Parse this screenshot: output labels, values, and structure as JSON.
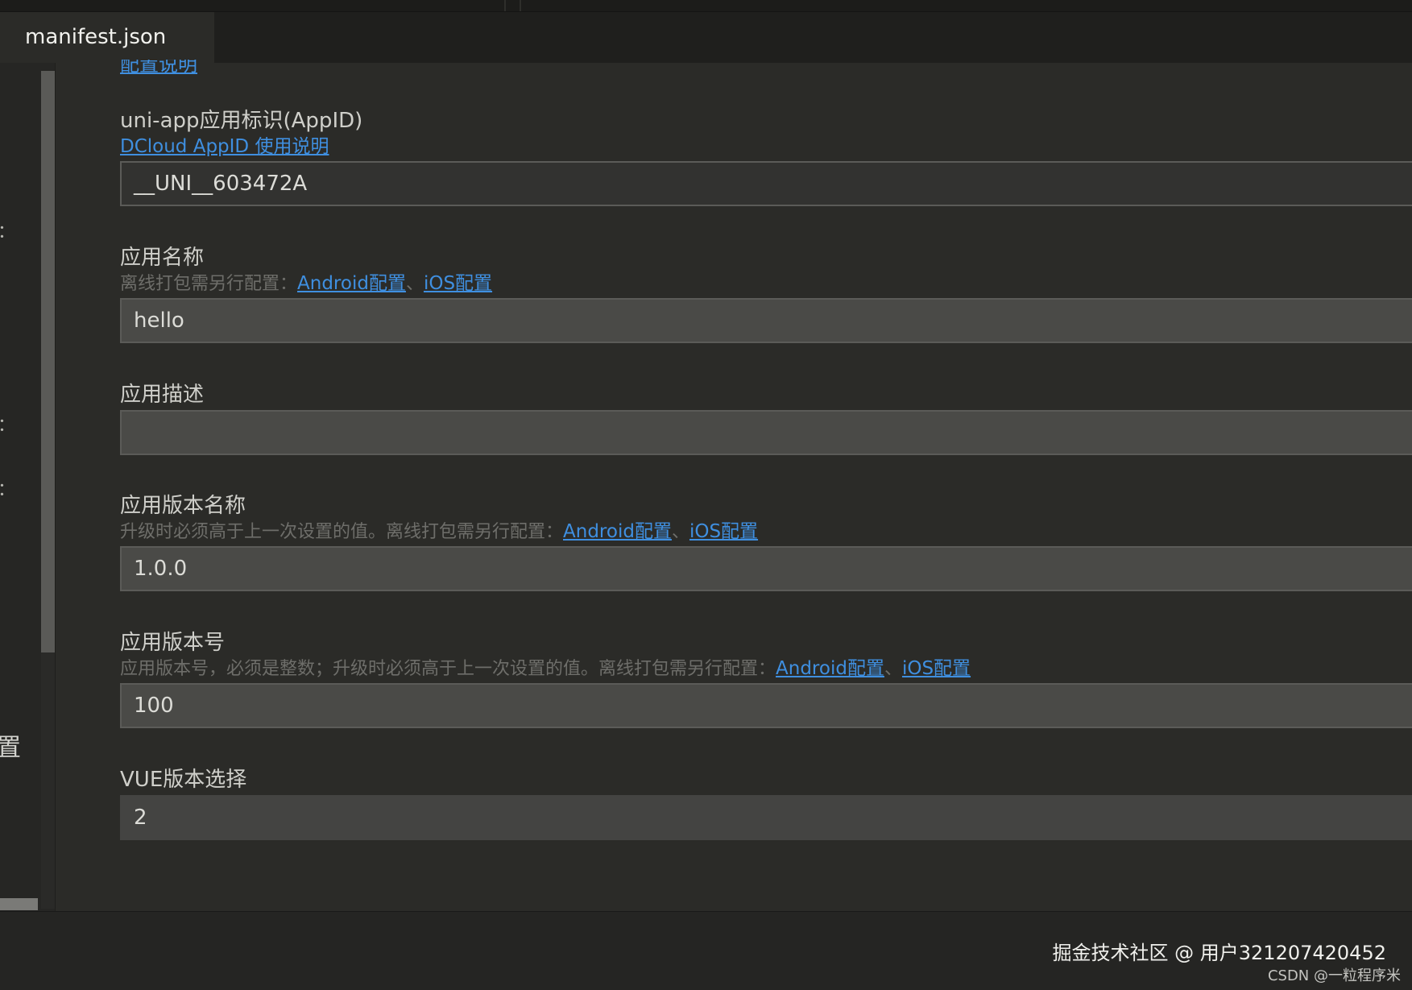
{
  "tab": {
    "label": "manifest.json"
  },
  "sidebar": {
    "fragments": [
      "：",
      "：",
      "：",
      "置"
    ]
  },
  "fields": {
    "appid": {
      "label": "uni-app应用标识(AppID)",
      "help_link": "DCloud AppID 使用说明",
      "value": "__UNI__603472A"
    },
    "app_name": {
      "label": "应用名称",
      "hint": "离线打包需另行配置：",
      "link_android": "Android配置",
      "separator": "、",
      "link_ios": "iOS配置",
      "value": "hello"
    },
    "app_description": {
      "label": "应用描述",
      "value": ""
    },
    "version_name": {
      "label": "应用版本名称",
      "hint": "升级时必须高于上一次设置的值。离线打包需另行配置：",
      "link_android": "Android配置",
      "separator": "、",
      "link_ios": "iOS配置",
      "value": "1.0.0"
    },
    "version_code": {
      "label": "应用版本号",
      "hint": "应用版本号，必须是整数；升级时必须高于上一次设置的值。离线打包需另行配置：",
      "link_android": "Android配置",
      "separator": "、",
      "link_ios": "iOS配置",
      "value": "100"
    },
    "vue_version": {
      "label": "VUE版本选择",
      "value": "2"
    }
  },
  "watermark": {
    "main": "掘金技术社区 @ 用户321207420452",
    "sub": "CSDN @一粒程序米"
  }
}
